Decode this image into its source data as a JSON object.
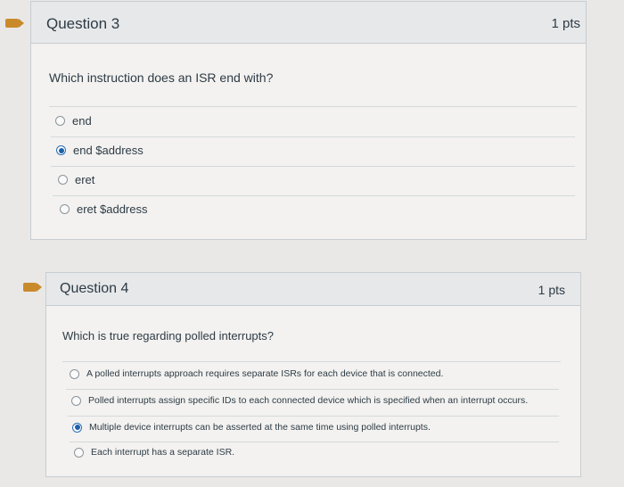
{
  "questions": [
    {
      "title": "Question 3",
      "points": "1 pts",
      "prompt": "Which instruction does an ISR end with?",
      "answers": [
        {
          "label": "end",
          "selected": false
        },
        {
          "label": "end $address",
          "selected": true
        },
        {
          "label": "eret",
          "selected": false
        },
        {
          "label": "eret $address",
          "selected": false
        }
      ]
    },
    {
      "title": "Question 4",
      "points": "1 pts",
      "prompt": "Which is true regarding polled interrupts?",
      "answers": [
        {
          "label": "A polled interrupts approach requires separate ISRs for each device that is connected.",
          "selected": false
        },
        {
          "label": "Polled interrupts assign specific IDs to each connected device which is specified when an interrupt occurs.",
          "selected": false
        },
        {
          "label": "Multiple device interrupts can be asserted at the same time using polled interrupts.",
          "selected": true
        },
        {
          "label": "Each interrupt has a separate ISR.",
          "selected": false
        }
      ]
    }
  ],
  "colors": {
    "accent_marker": "#c98a2b",
    "radio_selected": "#1e5fa8",
    "header_bg": "#e7e8ea",
    "card_bg": "#f3f2f0"
  },
  "icons": [
    "question-marker-icon",
    "radio-unselected-icon",
    "radio-selected-icon"
  ]
}
